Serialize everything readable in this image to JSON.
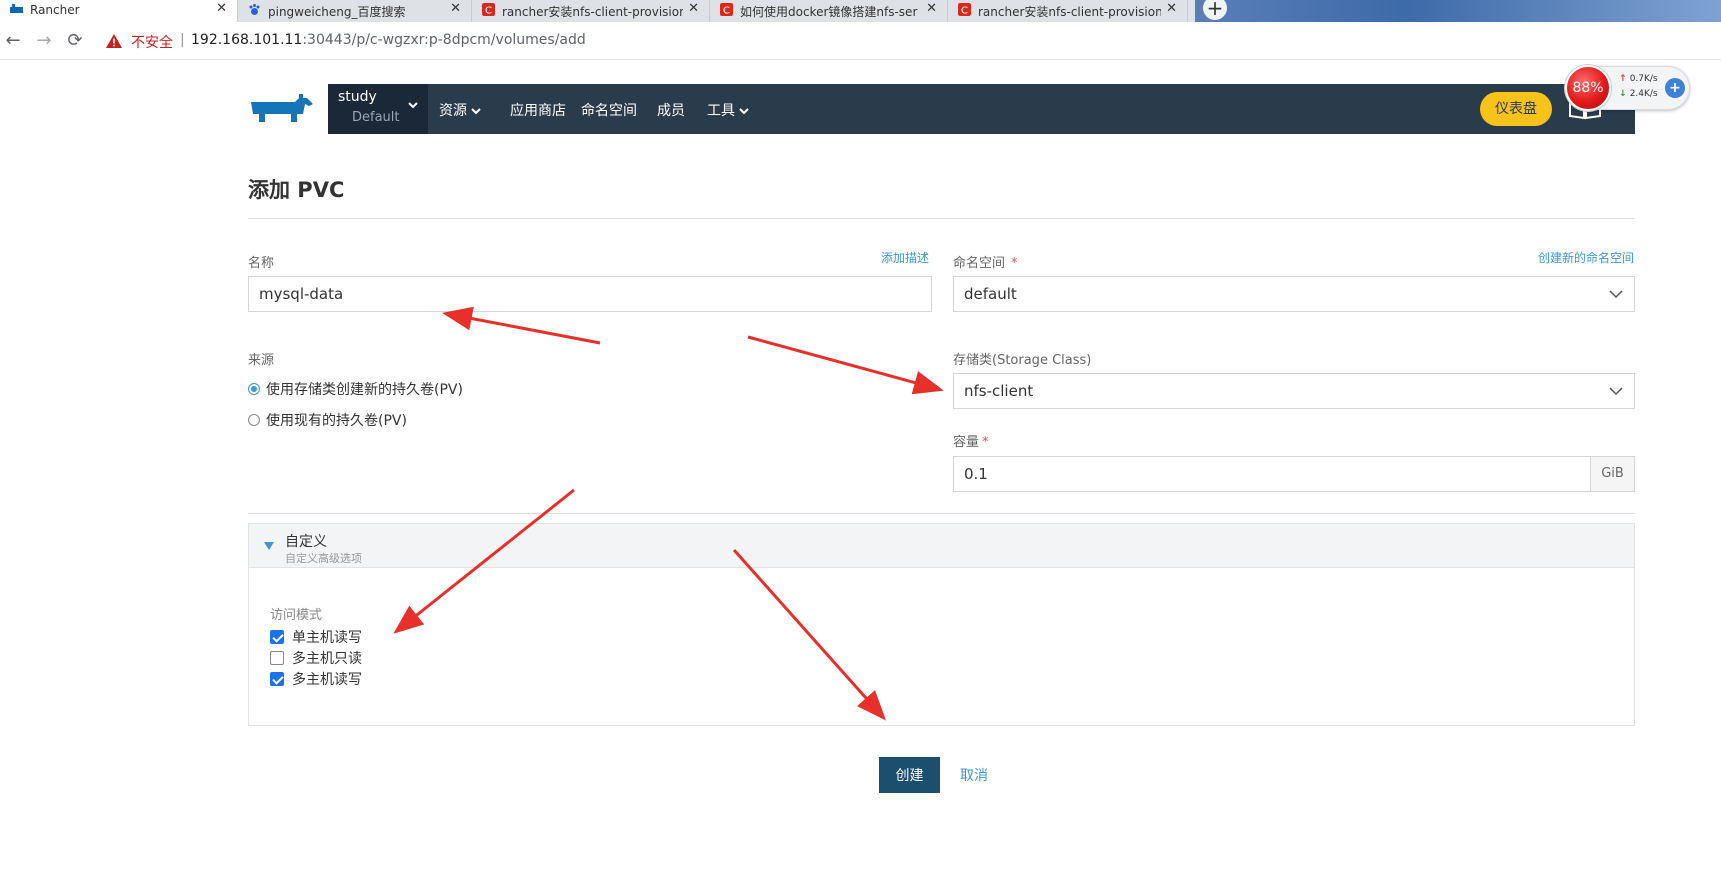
{
  "browser": {
    "tabs": [
      {
        "label": "Rancher",
        "icon": "rancher-icon",
        "active": true
      },
      {
        "label": "pingweicheng_百度搜索",
        "icon": "baidu-paw-icon",
        "active": false
      },
      {
        "label": "rancher安装nfs-client-provision",
        "icon": "csdn-icon",
        "active": false
      },
      {
        "label": "如何使用docker镜像搭建nfs-ser",
        "icon": "csdn-icon",
        "active": false
      },
      {
        "label": "rancher安装nfs-client-provision",
        "icon": "csdn-icon",
        "active": false
      }
    ],
    "new_tab": "+",
    "back": "←",
    "forward": "→",
    "reload": "⟳",
    "security_label": "不安全",
    "separator": "|",
    "url_host": "192.168.101.11",
    "url_rest": ":30443/p/c-wgzxr:p-8dpcm/volumes/add"
  },
  "header": {
    "cluster_name": "study",
    "project_name": "Default",
    "nav": [
      "资源",
      "应用商店",
      "命名空间",
      "成员",
      "工具"
    ],
    "dashboard_label": "仪表盘"
  },
  "speed_widget": {
    "percent": "88%",
    "upload": "0.7K/s",
    "download": "2.4K/s"
  },
  "page": {
    "title": "添加 PVC",
    "name_label": "名称",
    "add_description": "添加描述",
    "name_value": "mysql-data",
    "namespace_label": "命名空间",
    "required_mark": "*",
    "create_namespace": "创建新的命名空间",
    "namespace_value": "default",
    "source_label": "来源",
    "source_options": [
      {
        "label": "使用存储类创建新的持久卷(PV)",
        "selected": true
      },
      {
        "label": "使用现有的持久卷(PV)",
        "selected": false
      }
    ],
    "storage_class_label": "存储类(Storage Class)",
    "storage_class_value": "nfs-client",
    "capacity_label": "容量",
    "capacity_value": "0.1",
    "capacity_unit": "GiB",
    "custom_title": "自定义",
    "custom_subtitle": "自定义高级选项",
    "access_mode_label": "访问模式",
    "access_modes": [
      {
        "label": "单主机读写",
        "checked": true
      },
      {
        "label": "多主机只读",
        "checked": false
      },
      {
        "label": "多主机读写",
        "checked": true
      }
    ],
    "create_button": "创建",
    "cancel_button": "取消"
  },
  "colors": {
    "header_bg": "#2a3b4c",
    "accent_yellow": "#f7c21a",
    "primary_button": "#1a4f6e",
    "link_blue": "#3d98d3",
    "annotation_red": "#e8302a"
  }
}
